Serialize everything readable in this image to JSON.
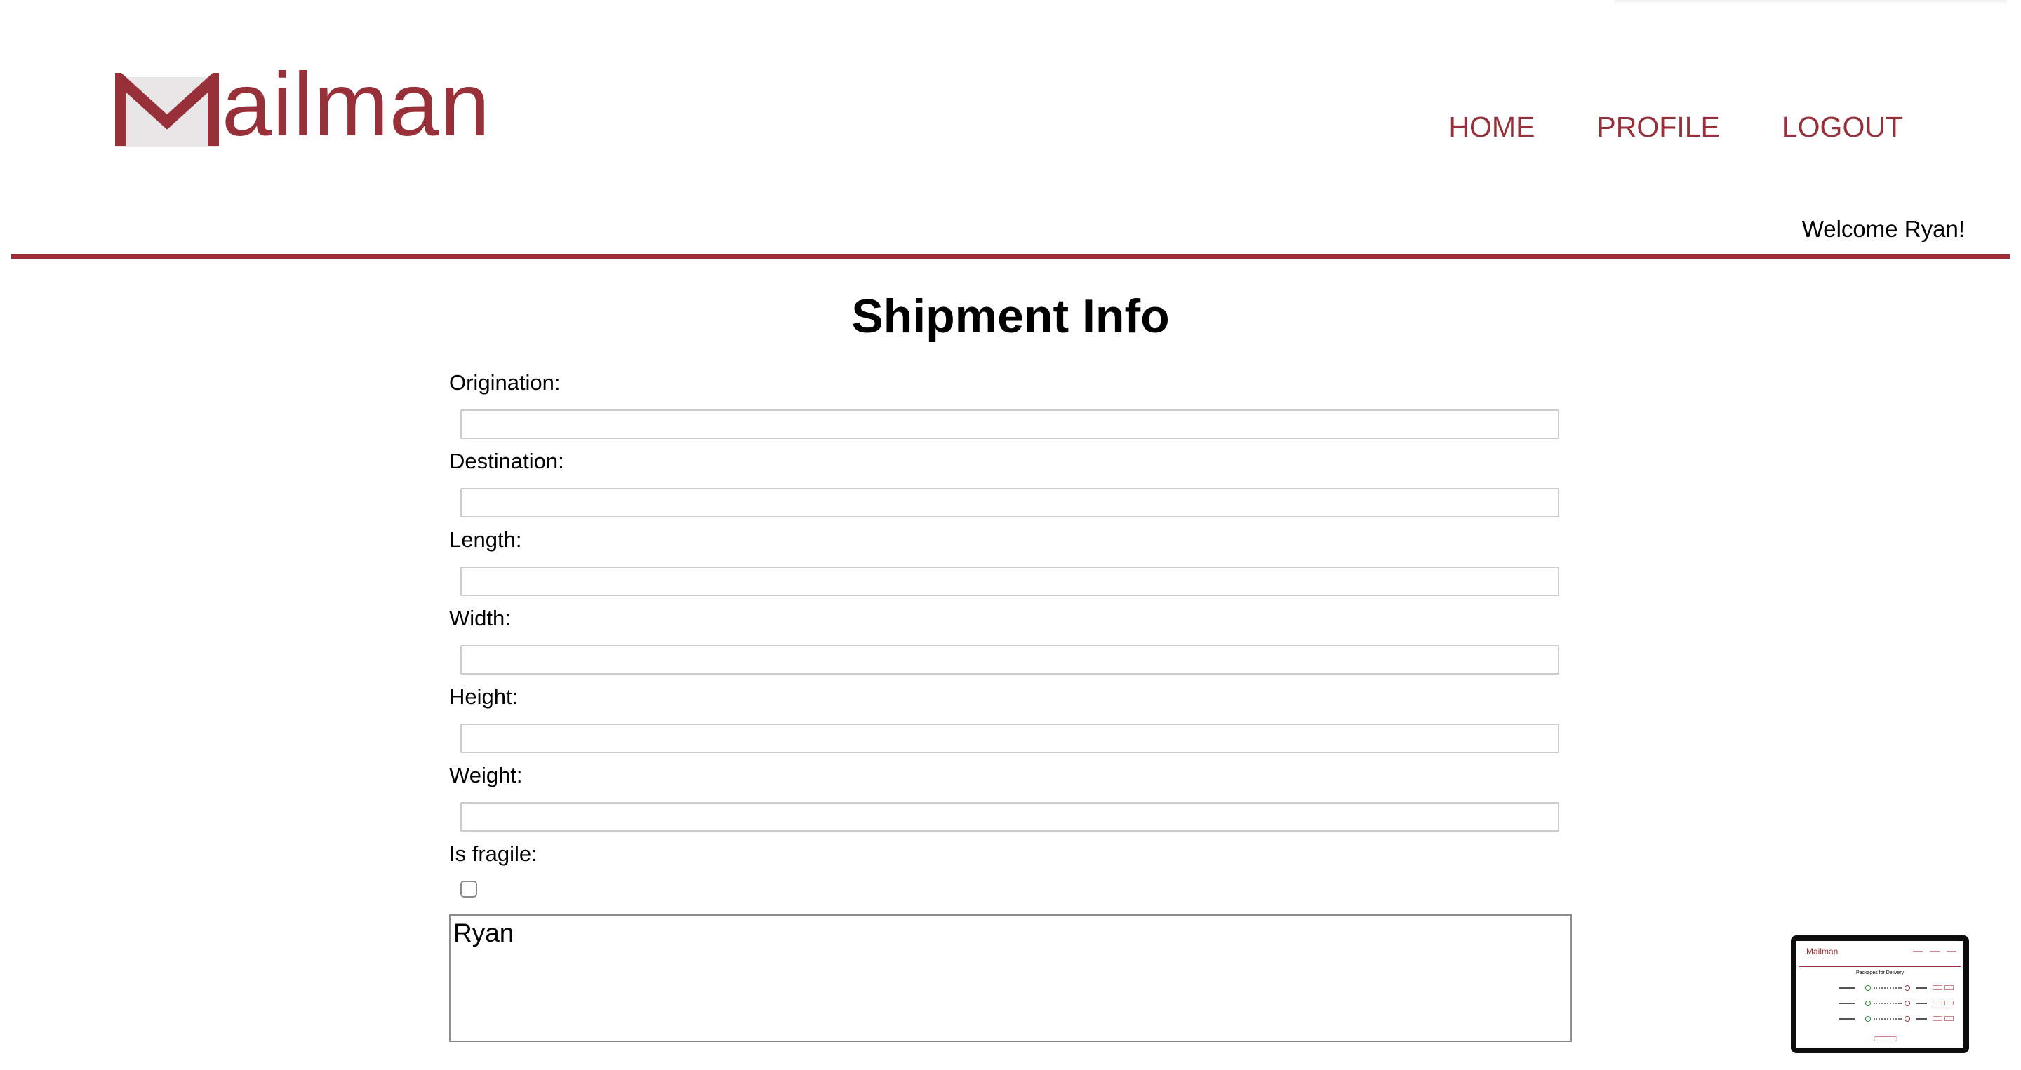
{
  "app": {
    "logo_text": "ailman",
    "logo_letter": "M"
  },
  "nav": {
    "items": [
      {
        "label": "HOME"
      },
      {
        "label": "PROFILE"
      },
      {
        "label": "LOGOUT"
      }
    ]
  },
  "welcome_text": "Welcome Ryan!",
  "page_title": "Shipment Info",
  "form": {
    "fields": [
      {
        "label": "Origination:",
        "value": ""
      },
      {
        "label": "Destination:",
        "value": ""
      },
      {
        "label": "Length:",
        "value": ""
      },
      {
        "label": "Width:",
        "value": ""
      },
      {
        "label": "Height:",
        "value": ""
      },
      {
        "label": "Weight:",
        "value": ""
      }
    ],
    "fragile": {
      "label": "Is fragile:",
      "checked": false
    },
    "notes_value": "Ryan"
  },
  "colors": {
    "brand": "#98303a",
    "divider": "#98303a"
  },
  "thumbnail": {
    "title": "Packages for Delivery",
    "logo_text": "Mailman"
  }
}
